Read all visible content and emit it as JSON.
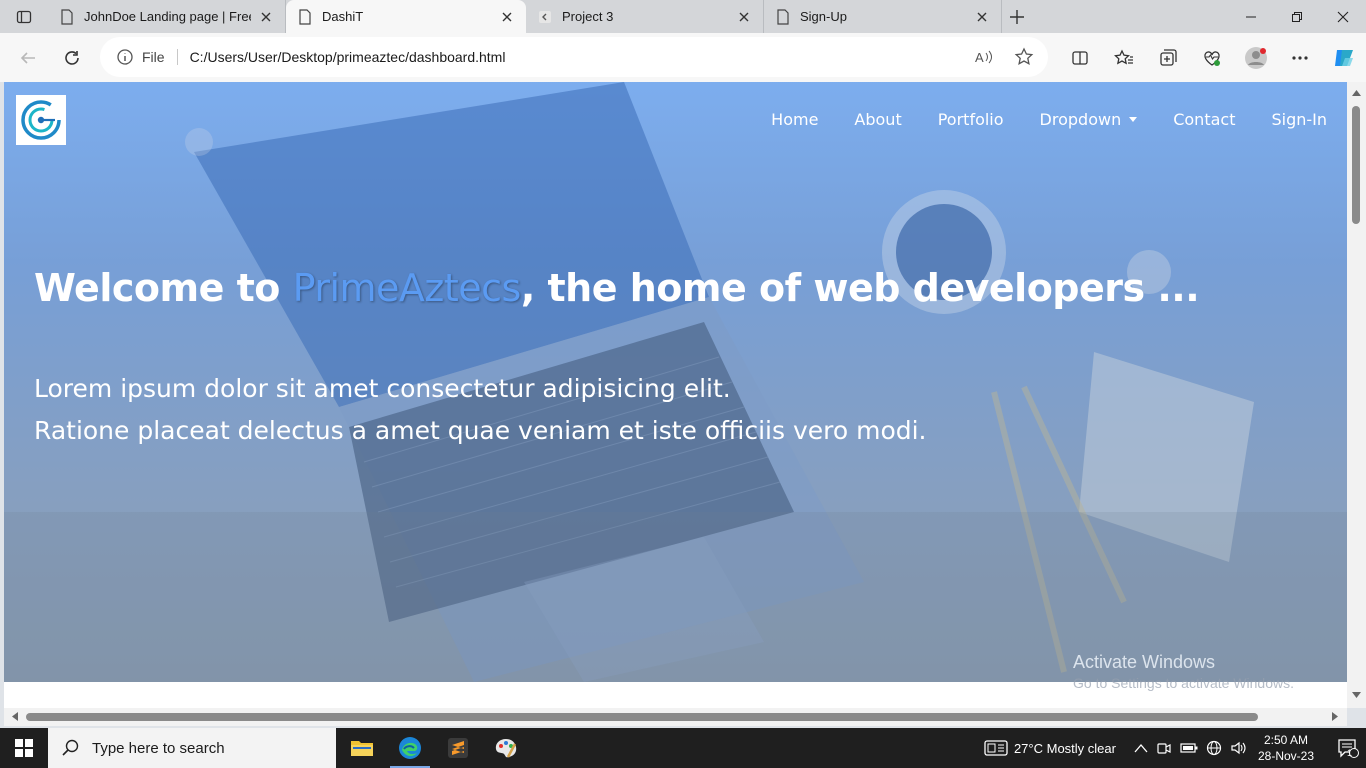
{
  "browser": {
    "tabs": [
      {
        "title": "JohnDoe Landing page | Free Bo",
        "active": false
      },
      {
        "title": "DashiT",
        "active": true
      },
      {
        "title": "Project 3",
        "active": false
      },
      {
        "title": "Sign-Up",
        "active": false
      }
    ],
    "address": {
      "scheme": "File",
      "url": "C:/Users/User/Desktop/primeaztec/dashboard.html"
    }
  },
  "site": {
    "nav": {
      "home": "Home",
      "about": "About",
      "portfolio": "Portfolio",
      "dropdown": "Dropdown",
      "contact": "Contact",
      "signin": "Sign-In"
    },
    "hero": {
      "title_prefix": "Welcome to ",
      "brand": "PrimeAztecs",
      "title_suffix": ", the home of web developers ...",
      "line1": "Lorem ipsum dolor sit amet consectetur adipisicing elit.",
      "line2": "Ratione placeat delectus a amet quae veniam et iste officiis vero modi."
    }
  },
  "watermark": {
    "title": "Activate Windows",
    "subtitle": "Go to Settings to activate Windows."
  },
  "taskbar": {
    "search_placeholder": "Type here to search",
    "weather": "27°C  Mostly clear",
    "time": "2:50 AM",
    "date": "28-Nov-23",
    "notification_count": "1"
  },
  "colors": {
    "brand_text": "#5b9bf2",
    "hero_overlay": "#5a8fe0"
  }
}
